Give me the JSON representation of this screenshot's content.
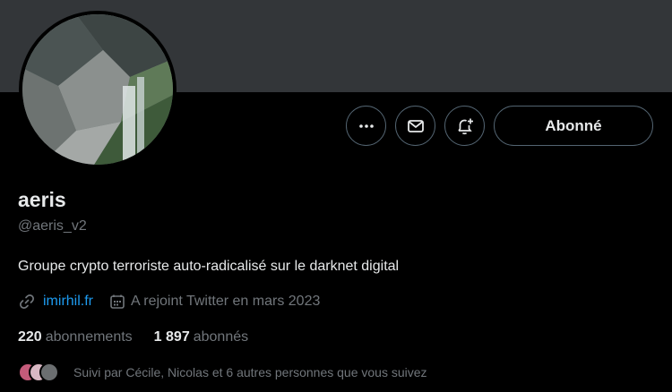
{
  "profile": {
    "name": "aeris",
    "handle": "@aeris_v2",
    "bio": "Groupe crypto terroriste auto-radicalisé sur le darknet digital",
    "website": "imirhil.fr",
    "joined": "A rejoint Twitter en mars 2023"
  },
  "actions": {
    "follow_label": "Abonné"
  },
  "stats": {
    "following_count": "220",
    "following_label": "abonnements",
    "followers_count": "1 897",
    "followers_label": "abonnés"
  },
  "followed_by": "Suivi par Cécile, Nicolas et 6 autres personnes que vous suivez",
  "icons": [
    "more-icon",
    "mail-icon",
    "notification-add-icon",
    "link-icon",
    "calendar-icon"
  ],
  "colors": {
    "accent": "#1d9bf0",
    "muted": "#71767b",
    "text": "#e7e9ea",
    "banner": "#333639"
  }
}
